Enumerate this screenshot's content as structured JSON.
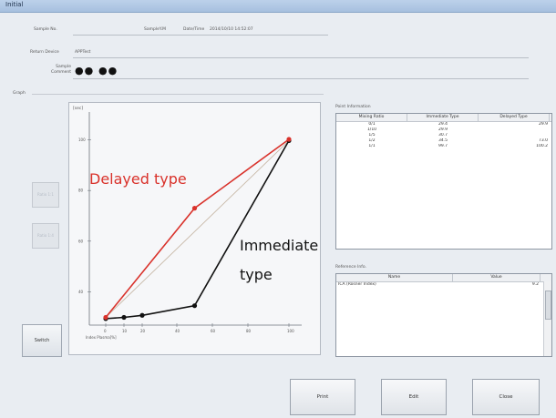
{
  "window": {
    "title": "Initial"
  },
  "sample": {
    "sample_no_label": "Sample No.",
    "sample_id_value": "SampleY.M",
    "datetime_label": "Date/Time",
    "datetime_value": "2014/10/10 14:52:07",
    "device_label": "Return Device",
    "device_value": "APPTest",
    "comment_label": "Sample Comment",
    "comment_value": "●● ●●"
  },
  "graph": {
    "group_label": "Graph",
    "ratio_1_1_button": "Ratio 1:1",
    "ratio_1_4_button": "Ratio 1:4",
    "switch_button": "Switch"
  },
  "chart_data": {
    "type": "line",
    "ylabel": "[sec]",
    "xlabel": "Index Plasma[%]",
    "x_ticks": [
      "0",
      "10",
      "20",
      "40",
      "60",
      "80",
      "100"
    ],
    "y_ticks": [
      "100",
      "80",
      "60",
      "40"
    ],
    "series": [
      {
        "name": "Immediate type",
        "color": "#111111",
        "points": [
          [
            0,
            29.4
          ],
          [
            10,
            29.9
          ],
          [
            20,
            30.7
          ],
          [
            50,
            34.5
          ],
          [
            100,
            99.7
          ]
        ]
      },
      {
        "name": "Delayed type",
        "color": "#d9322b",
        "points": [
          [
            0,
            29.9
          ],
          [
            50,
            73.0
          ],
          [
            100,
            100.2
          ]
        ]
      }
    ],
    "reference_line": {
      "color": "#c8b9a8",
      "points": [
        [
          0,
          29.9
        ],
        [
          100,
          99.7
        ]
      ]
    }
  },
  "annotations": {
    "delayed": "Delayed type",
    "immediate_1": "Immediate",
    "immediate_2": "type",
    "delayed_color": "#d9322b",
    "immediate_color": "#111111"
  },
  "point_info": {
    "group_label": "Point Information",
    "columns": [
      "Mixing Ratio",
      "Immediate Type",
      "Delayed Type"
    ],
    "rows": [
      [
        "0/1",
        "29.4",
        "29.9"
      ],
      [
        "1/10",
        "29.9",
        ""
      ],
      [
        "1/5",
        "30.7",
        ""
      ],
      [
        "1/2",
        "34.5",
        "73.0"
      ],
      [
        "1/1",
        "99.7",
        "100.2"
      ]
    ]
  },
  "reference_info": {
    "group_label": "Reference Info.",
    "columns": [
      "Name",
      "Value"
    ],
    "rows": [
      [
        "ICA (Rosner Index)",
        "9.2"
      ]
    ]
  },
  "buttons": {
    "print": "Print",
    "edit": "Edit",
    "close": "Close"
  }
}
